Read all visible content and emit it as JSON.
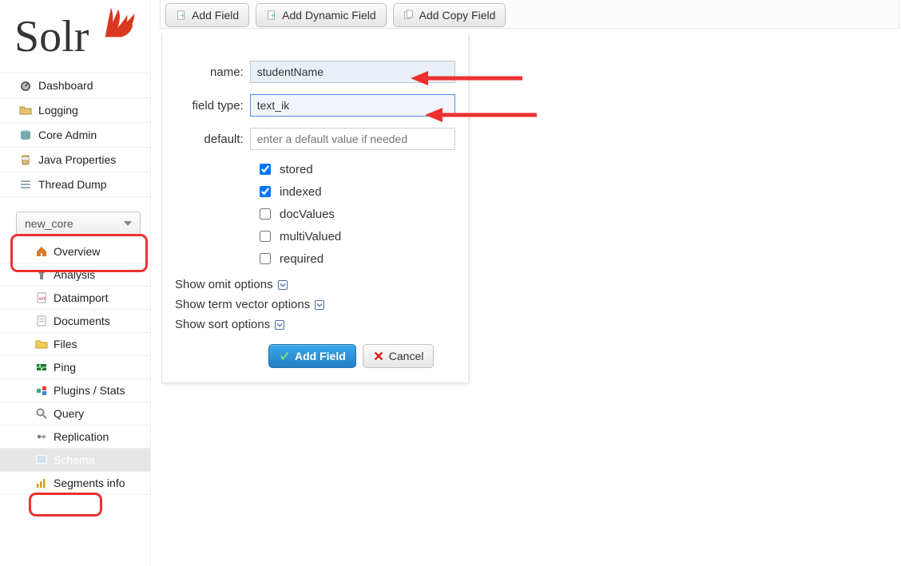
{
  "logo": {
    "text": "Solr"
  },
  "sidebar": {
    "items": [
      {
        "label": "Dashboard",
        "icon": "gauge-icon"
      },
      {
        "label": "Logging",
        "icon": "folder-icon"
      },
      {
        "label": "Core Admin",
        "icon": "stack-icon"
      },
      {
        "label": "Java Properties",
        "icon": "jar-icon"
      },
      {
        "label": "Thread Dump",
        "icon": "threads-icon"
      }
    ],
    "core_selector": "new_core",
    "sub_items": [
      {
        "label": "Overview",
        "icon": "home-icon"
      },
      {
        "label": "Analysis",
        "icon": "funnel-icon"
      },
      {
        "label": "Dataimport",
        "icon": "xml-icon"
      },
      {
        "label": "Documents",
        "icon": "doc-icon"
      },
      {
        "label": "Files",
        "icon": "folder-open-icon"
      },
      {
        "label": "Ping",
        "icon": "ping-icon"
      },
      {
        "label": "Plugins / Stats",
        "icon": "plugin-icon"
      },
      {
        "label": "Query",
        "icon": "search-icon"
      },
      {
        "label": "Replication",
        "icon": "replication-icon"
      },
      {
        "label": "Schema",
        "icon": "book-icon",
        "selected": true
      },
      {
        "label": "Segments info",
        "icon": "segments-icon"
      }
    ]
  },
  "toolbar": {
    "add_field_label": "Add Field",
    "add_dynamic_field_label": "Add Dynamic Field",
    "add_copy_field_label": "Add Copy Field"
  },
  "form": {
    "name_label": "name:",
    "name_value": "studentName",
    "field_type_label": "field type:",
    "field_type_value": "text_ik",
    "default_label": "default:",
    "default_placeholder": "enter a default value if needed",
    "checks": {
      "stored": {
        "label": "stored",
        "checked": true
      },
      "indexed": {
        "label": "indexed",
        "checked": true
      },
      "docValues": {
        "label": "docValues",
        "checked": false
      },
      "multiValued": {
        "label": "multiValued",
        "checked": false
      },
      "required": {
        "label": "required",
        "checked": false
      }
    },
    "show_omit_label": "Show omit options",
    "show_term_vector_label": "Show term vector options",
    "show_sort_label": "Show sort options",
    "submit_label": "Add Field",
    "cancel_label": "Cancel"
  },
  "colors": {
    "accent_red": "#ec3030",
    "accent_blue": "#0d86cc"
  }
}
